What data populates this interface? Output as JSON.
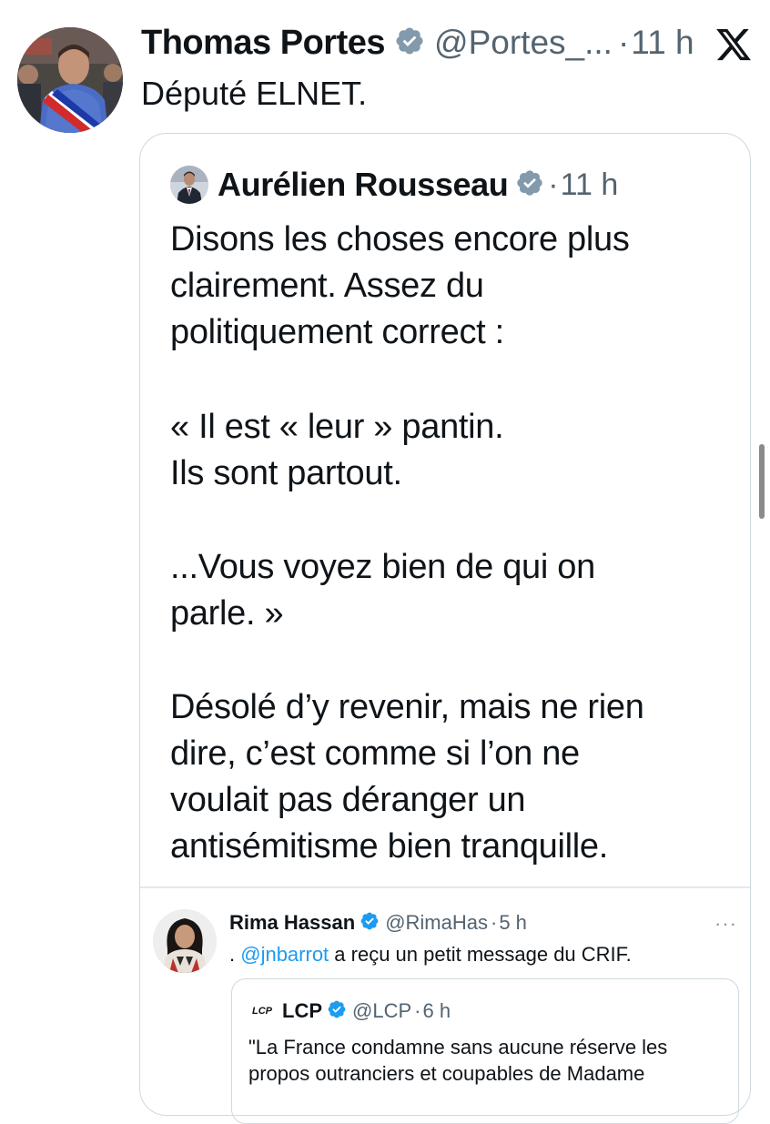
{
  "colors": {
    "verified_blue": "#1d9bf0",
    "verified_gray": "#829aab",
    "mention": "#1d9bf0",
    "secondary_text": "#536471",
    "border": "#cfd9de"
  },
  "icons": {
    "verified": "verified-badge-icon",
    "x_logo": "x-logo-icon",
    "more": "more-horizontal-icon"
  },
  "main_post": {
    "author_name": "Thomas Portes",
    "handle": "@Portes_...",
    "separator": "·",
    "time": "11 h",
    "text": "Député ELNET."
  },
  "quote_post": {
    "author_name": "Aurélien Rousseau",
    "separator": "·",
    "time": "11 h",
    "paragraphs": [
      "Disons les choses encore plus\nclairement. Assez du\npolitiquement correct :",
      "« Il est « leur » pantin.\nIls sont partout.",
      "...Vous voyez bien de qui on\nparle. »",
      "Désolé d’y revenir, mais ne rien\ndire, c’est comme si l’on ne\nvoulait pas déranger un\nantisémitisme bien tranquille."
    ],
    "nested_post": {
      "author_name": "Rima Hassan",
      "handle": "@RimaHas",
      "separator": "·",
      "time": "5 h",
      "more": "···",
      "text_prefix": ". ",
      "mention": "@jnbarrot",
      "text_suffix": " a reçu un petit message du CRIF.",
      "nested_quote": {
        "logo_text": "LCP",
        "author_name": "LCP",
        "handle": "@LCP",
        "separator": "·",
        "time": "6 h",
        "text": "\"La France condamne sans aucune réserve les\npropos outranciers et coupables de Madame"
      }
    }
  }
}
